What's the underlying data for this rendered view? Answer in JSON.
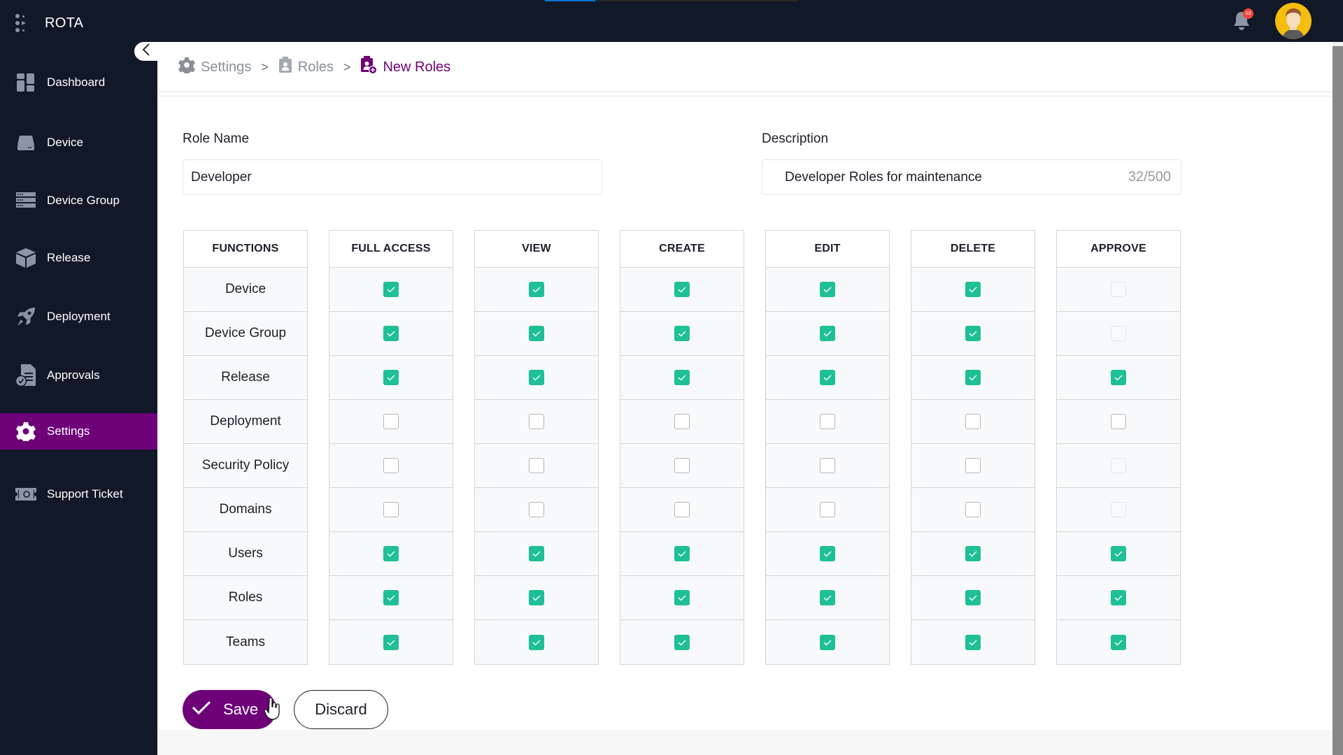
{
  "app": {
    "name": "ROTA",
    "loading_progress_percent": 20,
    "notifications": {
      "count_badge": "03"
    }
  },
  "sidebar": {
    "collapse_icon": "chevron-left-icon",
    "items": [
      {
        "label": "Dashboard",
        "icon": "dashboard-icon",
        "active": false
      },
      {
        "label": "Device",
        "icon": "device-icon",
        "active": false
      },
      {
        "label": "Device Group",
        "icon": "device-group-icon",
        "active": false
      },
      {
        "label": "Release",
        "icon": "box-icon",
        "active": false
      },
      {
        "label": "Deployment",
        "icon": "rocket-icon",
        "active": false
      },
      {
        "label": "Approvals",
        "icon": "approval-doc-icon",
        "active": false
      },
      {
        "label": "Settings",
        "icon": "gear-icon",
        "active": true
      },
      {
        "label": "Support Ticket",
        "icon": "ticket-icon",
        "active": false
      }
    ]
  },
  "breadcrumb": [
    {
      "label": "Settings",
      "icon": "gear-icon"
    },
    {
      "label": "Roles",
      "icon": "id-badge-icon"
    },
    {
      "label": "New Roles",
      "icon": "id-badge-add-icon"
    }
  ],
  "form": {
    "role_name": {
      "label": "Role Name",
      "value": "Developer"
    },
    "description": {
      "label": "Description",
      "value": "Developer Roles for maintenance",
      "counter": "32/500"
    }
  },
  "permissions": {
    "function_header": "FUNCTIONS",
    "columns": [
      "FULL ACCESS",
      "VIEW",
      "CREATE",
      "EDIT",
      "DELETE",
      "APPROVE"
    ],
    "rows": [
      {
        "name": "Device",
        "states": [
          "on",
          "on",
          "on",
          "on",
          "on",
          "disabled"
        ]
      },
      {
        "name": "Device Group",
        "states": [
          "on",
          "on",
          "on",
          "on",
          "on",
          "disabled"
        ]
      },
      {
        "name": "Release",
        "states": [
          "on",
          "on",
          "on",
          "on",
          "on",
          "on"
        ]
      },
      {
        "name": "Deployment",
        "states": [
          "off",
          "off",
          "off",
          "off",
          "off",
          "off"
        ]
      },
      {
        "name": "Security Policy",
        "states": [
          "off",
          "off",
          "off",
          "off",
          "off",
          "disabled"
        ]
      },
      {
        "name": "Domains",
        "states": [
          "off",
          "off",
          "off",
          "off",
          "off",
          "disabled"
        ]
      },
      {
        "name": "Users",
        "states": [
          "on",
          "on",
          "on",
          "on",
          "on",
          "on"
        ]
      },
      {
        "name": "Roles",
        "states": [
          "on",
          "on",
          "on",
          "on",
          "on",
          "on"
        ]
      },
      {
        "name": "Teams",
        "states": [
          "on",
          "on",
          "on",
          "on",
          "on",
          "on"
        ]
      }
    ]
  },
  "actions": {
    "save_label": "Save",
    "discard_label": "Discard"
  },
  "colors": {
    "brand_purple": "#6e0078",
    "checkbox_green": "#1fbf97",
    "topbar_bg": "#111827",
    "progress_blue": "#0a74d6",
    "badge_red": "#f44336"
  }
}
